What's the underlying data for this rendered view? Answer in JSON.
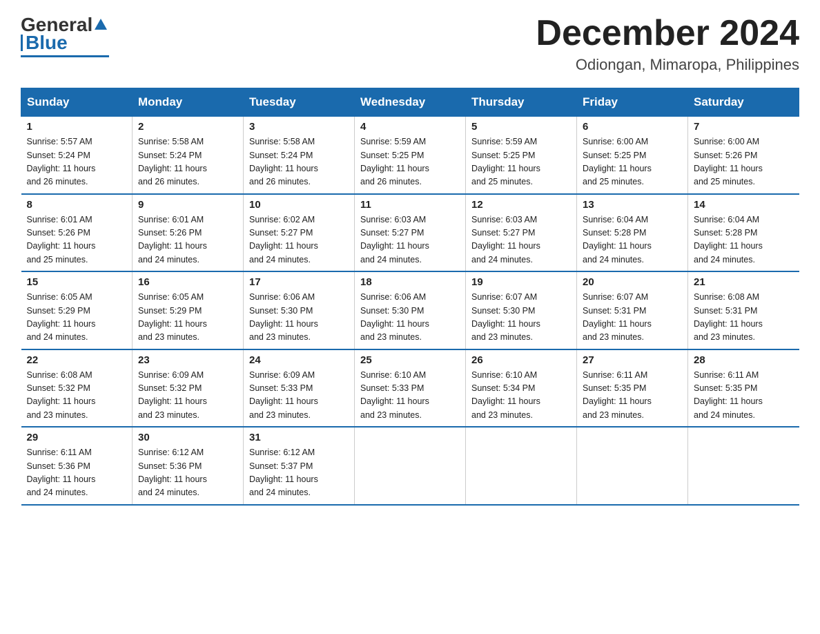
{
  "logo": {
    "general": "General",
    "blue": "Blue"
  },
  "header": {
    "title": "December 2024",
    "subtitle": "Odiongan, Mimaropa, Philippines"
  },
  "days_of_week": [
    "Sunday",
    "Monday",
    "Tuesday",
    "Wednesday",
    "Thursday",
    "Friday",
    "Saturday"
  ],
  "weeks": [
    [
      {
        "day": "1",
        "sunrise": "5:57 AM",
        "sunset": "5:24 PM",
        "daylight": "11 hours and 26 minutes."
      },
      {
        "day": "2",
        "sunrise": "5:58 AM",
        "sunset": "5:24 PM",
        "daylight": "11 hours and 26 minutes."
      },
      {
        "day": "3",
        "sunrise": "5:58 AM",
        "sunset": "5:24 PM",
        "daylight": "11 hours and 26 minutes."
      },
      {
        "day": "4",
        "sunrise": "5:59 AM",
        "sunset": "5:25 PM",
        "daylight": "11 hours and 26 minutes."
      },
      {
        "day": "5",
        "sunrise": "5:59 AM",
        "sunset": "5:25 PM",
        "daylight": "11 hours and 25 minutes."
      },
      {
        "day": "6",
        "sunrise": "6:00 AM",
        "sunset": "5:25 PM",
        "daylight": "11 hours and 25 minutes."
      },
      {
        "day": "7",
        "sunrise": "6:00 AM",
        "sunset": "5:26 PM",
        "daylight": "11 hours and 25 minutes."
      }
    ],
    [
      {
        "day": "8",
        "sunrise": "6:01 AM",
        "sunset": "5:26 PM",
        "daylight": "11 hours and 25 minutes."
      },
      {
        "day": "9",
        "sunrise": "6:01 AM",
        "sunset": "5:26 PM",
        "daylight": "11 hours and 24 minutes."
      },
      {
        "day": "10",
        "sunrise": "6:02 AM",
        "sunset": "5:27 PM",
        "daylight": "11 hours and 24 minutes."
      },
      {
        "day": "11",
        "sunrise": "6:03 AM",
        "sunset": "5:27 PM",
        "daylight": "11 hours and 24 minutes."
      },
      {
        "day": "12",
        "sunrise": "6:03 AM",
        "sunset": "5:27 PM",
        "daylight": "11 hours and 24 minutes."
      },
      {
        "day": "13",
        "sunrise": "6:04 AM",
        "sunset": "5:28 PM",
        "daylight": "11 hours and 24 minutes."
      },
      {
        "day": "14",
        "sunrise": "6:04 AM",
        "sunset": "5:28 PM",
        "daylight": "11 hours and 24 minutes."
      }
    ],
    [
      {
        "day": "15",
        "sunrise": "6:05 AM",
        "sunset": "5:29 PM",
        "daylight": "11 hours and 24 minutes."
      },
      {
        "day": "16",
        "sunrise": "6:05 AM",
        "sunset": "5:29 PM",
        "daylight": "11 hours and 23 minutes."
      },
      {
        "day": "17",
        "sunrise": "6:06 AM",
        "sunset": "5:30 PM",
        "daylight": "11 hours and 23 minutes."
      },
      {
        "day": "18",
        "sunrise": "6:06 AM",
        "sunset": "5:30 PM",
        "daylight": "11 hours and 23 minutes."
      },
      {
        "day": "19",
        "sunrise": "6:07 AM",
        "sunset": "5:30 PM",
        "daylight": "11 hours and 23 minutes."
      },
      {
        "day": "20",
        "sunrise": "6:07 AM",
        "sunset": "5:31 PM",
        "daylight": "11 hours and 23 minutes."
      },
      {
        "day": "21",
        "sunrise": "6:08 AM",
        "sunset": "5:31 PM",
        "daylight": "11 hours and 23 minutes."
      }
    ],
    [
      {
        "day": "22",
        "sunrise": "6:08 AM",
        "sunset": "5:32 PM",
        "daylight": "11 hours and 23 minutes."
      },
      {
        "day": "23",
        "sunrise": "6:09 AM",
        "sunset": "5:32 PM",
        "daylight": "11 hours and 23 minutes."
      },
      {
        "day": "24",
        "sunrise": "6:09 AM",
        "sunset": "5:33 PM",
        "daylight": "11 hours and 23 minutes."
      },
      {
        "day": "25",
        "sunrise": "6:10 AM",
        "sunset": "5:33 PM",
        "daylight": "11 hours and 23 minutes."
      },
      {
        "day": "26",
        "sunrise": "6:10 AM",
        "sunset": "5:34 PM",
        "daylight": "11 hours and 23 minutes."
      },
      {
        "day": "27",
        "sunrise": "6:11 AM",
        "sunset": "5:35 PM",
        "daylight": "11 hours and 23 minutes."
      },
      {
        "day": "28",
        "sunrise": "6:11 AM",
        "sunset": "5:35 PM",
        "daylight": "11 hours and 24 minutes."
      }
    ],
    [
      {
        "day": "29",
        "sunrise": "6:11 AM",
        "sunset": "5:36 PM",
        "daylight": "11 hours and 24 minutes."
      },
      {
        "day": "30",
        "sunrise": "6:12 AM",
        "sunset": "5:36 PM",
        "daylight": "11 hours and 24 minutes."
      },
      {
        "day": "31",
        "sunrise": "6:12 AM",
        "sunset": "5:37 PM",
        "daylight": "11 hours and 24 minutes."
      },
      null,
      null,
      null,
      null
    ]
  ],
  "labels": {
    "sunrise_prefix": "Sunrise: ",
    "sunset_prefix": "Sunset: ",
    "daylight_prefix": "Daylight: "
  }
}
